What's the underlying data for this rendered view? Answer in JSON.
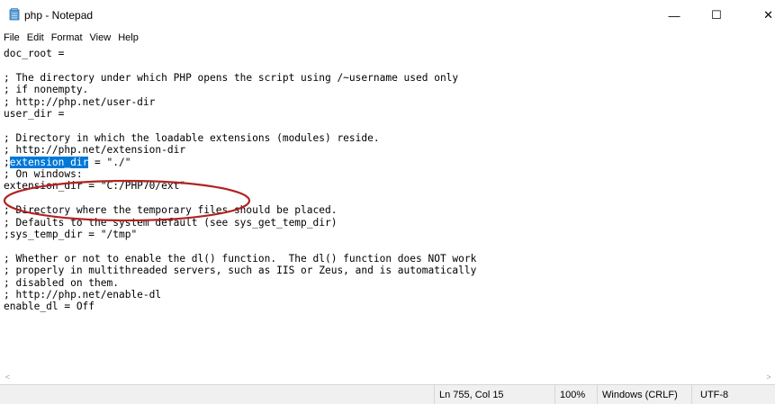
{
  "window": {
    "title": "php - Notepad",
    "controls": {
      "minimize": "—",
      "maximize": "☐",
      "close": "✕"
    }
  },
  "menu": [
    "File",
    "Edit",
    "Format",
    "View",
    "Help"
  ],
  "editor": {
    "lines": [
      "doc_root =",
      "",
      "; The directory under which PHP opens the script using /~username used only",
      "; if nonempty.",
      "; http://php.net/user-dir",
      "user_dir =",
      "",
      "; Directory in which the loadable extensions (modules) reside.",
      "; http://php.net/extension-dir",
      "; extension_dir = \"./\"",
      "; On windows:",
      "extension_dir = \"C:/PHP70/ext\"",
      "",
      "; Directory where the temporary files should be placed.",
      "; Defaults to the system default (see sys_get_temp_dir)",
      ";sys_temp_dir = \"/tmp\"",
      "",
      "; Whether or not to enable the dl() function.  The dl() function does NOT work",
      "; properly in multithreaded servers, such as IIS or Zeus, and is automatically",
      "; disabled on them.",
      "; http://php.net/enable-dl",
      "enable_dl = Off"
    ],
    "selected_line": {
      "prefix": ";",
      "selected": "extension_dir",
      "suffix": " = \"./\""
    },
    "annotation_color": "#b22222",
    "selection_color": "#0078d7"
  },
  "scrollbar": {
    "left_arrow": "<",
    "right_arrow": ">"
  },
  "status": {
    "position": "Ln 755, Col 15",
    "zoom": "100%",
    "line_ending": "Windows (CRLF)",
    "encoding": "UTF-8"
  }
}
